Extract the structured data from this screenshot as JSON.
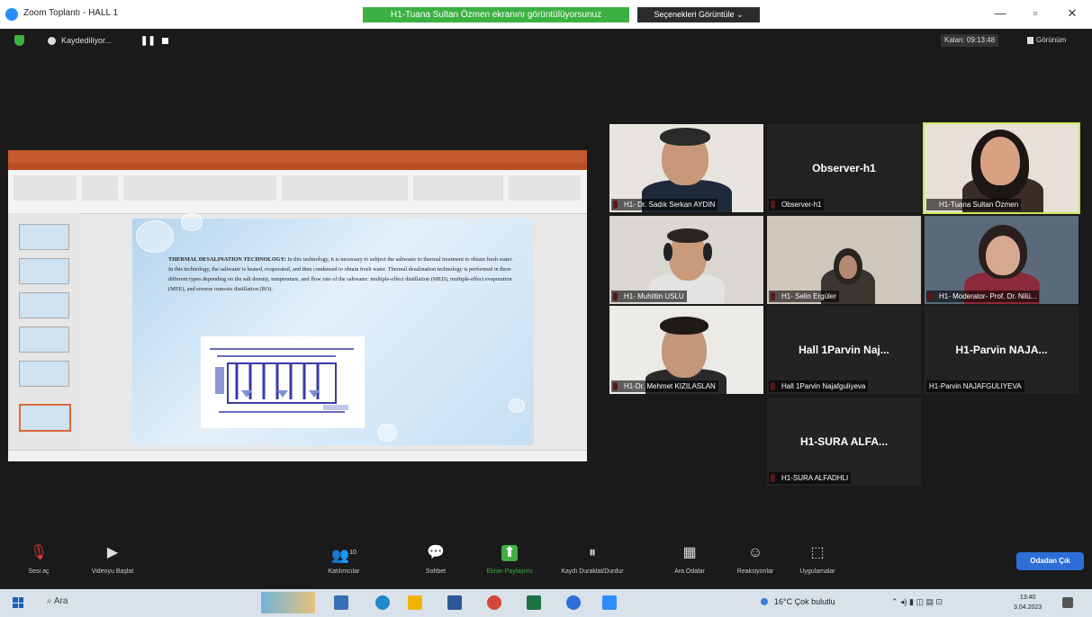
{
  "window": {
    "title": "Zoom Toplantı - HALL 1",
    "speaker_banner": "H1-Tuana Sultan Özmen ekranını görüntülüyorsunuz",
    "view_options": "Seçenekleri Görüntüle ⌄",
    "controls": [
      "—",
      "▫",
      "✕"
    ]
  },
  "topbar": {
    "recording_label": "Kaydediliyor...",
    "pause_symbol": "❚❚",
    "timer": "Kalan: 09:13:48",
    "view_label": "Görünüm"
  },
  "presentation": {
    "body_heading": "THERMAL DESALINATION TECHNOLOGY:",
    "body_text": "In this technology, it is necessary to subject the saltwater to thermal treatment to obtain fresh water. In this technology, the saltwater is heated, evaporated, and then condensed to obtain fresh water. Thermal desalination technology is performed in three different types depending on the salt density, temperature, and flow rate of the saltwater: multiple-effect distillation (MED), multiple-effect evaporation (MEE), and reverse osmosis distillation (RO)."
  },
  "participants": [
    {
      "name": "H1- Dr. Sadık Serkan AYDIN",
      "video": true,
      "skin": "#c9987a",
      "bg": "#e8e4df",
      "shirt": "#1e2a3a",
      "hair": "#2a2a2a"
    },
    {
      "name": "Observer-h1",
      "display": "Observer-h1",
      "video": false
    },
    {
      "name": "H1-Tuana Sultan Özmen",
      "video": true,
      "active": true,
      "skin": "#d9a184",
      "bg": "#e8e0d8",
      "shirt": "#3a2d28",
      "hair": "#1c1614"
    },
    {
      "name": "H1- Muhittin USLU",
      "video": true,
      "skin": "#c99a7b",
      "bg": "#dad6d2",
      "shirt": "#e3e3e3",
      "hair": "#2b2522"
    },
    {
      "name": "H1- Selin Ergüler",
      "video": true,
      "skin": "#b48a72",
      "bg": "#cfc8bc",
      "shirt": "#3a3530",
      "hair": "#2a2420"
    },
    {
      "name": "H1- Moderator- Prof. Dr. Nilü...",
      "video": true,
      "skin": "#d6a88f",
      "bg": "#5a6a7a",
      "shirt": "#8a2a3a",
      "hair": "#2a1f1c"
    },
    {
      "name": "H1-Dr. Mehmet KIZILASLAN",
      "video": true,
      "skin": "#c4967a",
      "bg": "#eceae6",
      "shirt": "#2a2a2a",
      "hair": "#1e1a18"
    },
    {
      "name": "Hall 1Parvin Najafguliyeva",
      "display": "Hall 1Parvin Naj...",
      "video": false
    },
    {
      "name": "H1-Parvin NAJAFGULIYEVA",
      "display": "H1-Parvin NAJA...",
      "video": false
    },
    {
      "name": "H1-SURA ALFADHLI",
      "display": "H1-SURA ALFA...",
      "video": false
    }
  ],
  "toolbar": {
    "items": [
      {
        "label": "Sesi aç",
        "icon": "mic-off-icon",
        "glyph": "🎙"
      },
      {
        "label": "Videoyu Başlat",
        "icon": "video-off-icon",
        "glyph": "▶"
      },
      {
        "label": "Katılımcılar",
        "icon": "participants-icon",
        "glyph": "👥",
        "count": "10"
      },
      {
        "label": "Sohbet",
        "icon": "chat-icon",
        "glyph": "💬"
      },
      {
        "label": "Ekran Paylaşımı",
        "icon": "share-screen-icon",
        "glyph": "⬆"
      },
      {
        "label": "Kaydı Duraklat/Durdur",
        "icon": "record-pause-icon",
        "glyph": "⏸"
      },
      {
        "label": "Ara Odalar",
        "icon": "breakout-rooms-icon",
        "glyph": "▦"
      },
      {
        "label": "Reaksiyonlar",
        "icon": "reactions-icon",
        "glyph": "☺"
      },
      {
        "label": "Uygulamalar",
        "icon": "apps-icon",
        "glyph": "⬚"
      }
    ],
    "leave_label": "Odadan Çık"
  },
  "taskbar": {
    "search_label": "Ara",
    "weather": "16°C  Çok bulutlu",
    "time": "13:40",
    "date": "3.04.2023"
  },
  "colors": {
    "speaker_banner": "#3cb043",
    "active_border": "#c8e65a",
    "leave_button": "#2d6fd6",
    "mic_muted": "#e03b3b"
  }
}
